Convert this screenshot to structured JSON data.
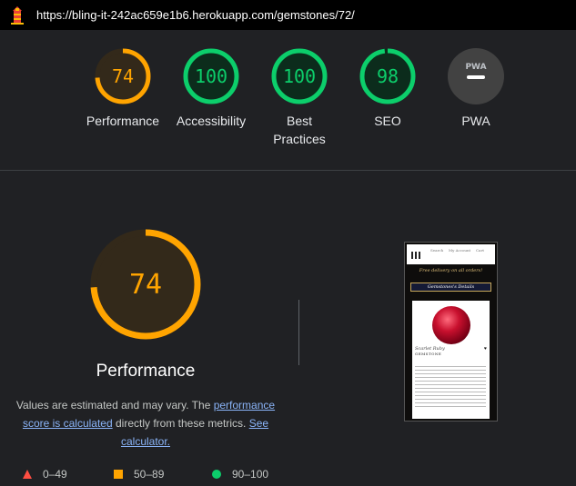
{
  "url": "https://bling-it-242ac659e1b6.herokuapp.com/gemstones/72/",
  "categories": [
    {
      "label": "Performance",
      "score": "74",
      "value": 74,
      "color": "#ffa400",
      "fill": "#33291a"
    },
    {
      "label": "Accessibility",
      "score": "100",
      "value": 100,
      "color": "#0cce6b",
      "fill": "#0c2c1c"
    },
    {
      "label": "Best Practices",
      "score": "100",
      "value": 100,
      "color": "#0cce6b",
      "fill": "#0c2c1c"
    },
    {
      "label": "SEO",
      "score": "98",
      "value": 98,
      "color": "#0cce6b",
      "fill": "#0c2c1c"
    },
    {
      "label": "PWA",
      "score": "PWA",
      "value": null,
      "color": "#5f6368",
      "fill": "#424242"
    }
  ],
  "main": {
    "score": "74",
    "value": 74,
    "title": "Performance",
    "estimate_prefix": "Values are estimated and may vary. The ",
    "estimate_link1": "performance score is calculated",
    "estimate_middle": " directly from these metrics. ",
    "estimate_link2": "See calculator."
  },
  "legend": [
    {
      "range": "0–49",
      "icon": "triangle-icon",
      "color": "#ff4e42"
    },
    {
      "range": "50–89",
      "icon": "square-icon",
      "color": "#ffa400"
    },
    {
      "range": "90–100",
      "icon": "circle-icon",
      "color": "#0cce6b"
    }
  ],
  "screenshot": {
    "nav_items": [
      "Search",
      "My Account",
      "Cart"
    ],
    "banner": "Free delivery on all orders!",
    "bar_title": "Gemstones's Details",
    "gem_title": "Scarlet Ruby",
    "gem_category": "GEMSTONE"
  }
}
